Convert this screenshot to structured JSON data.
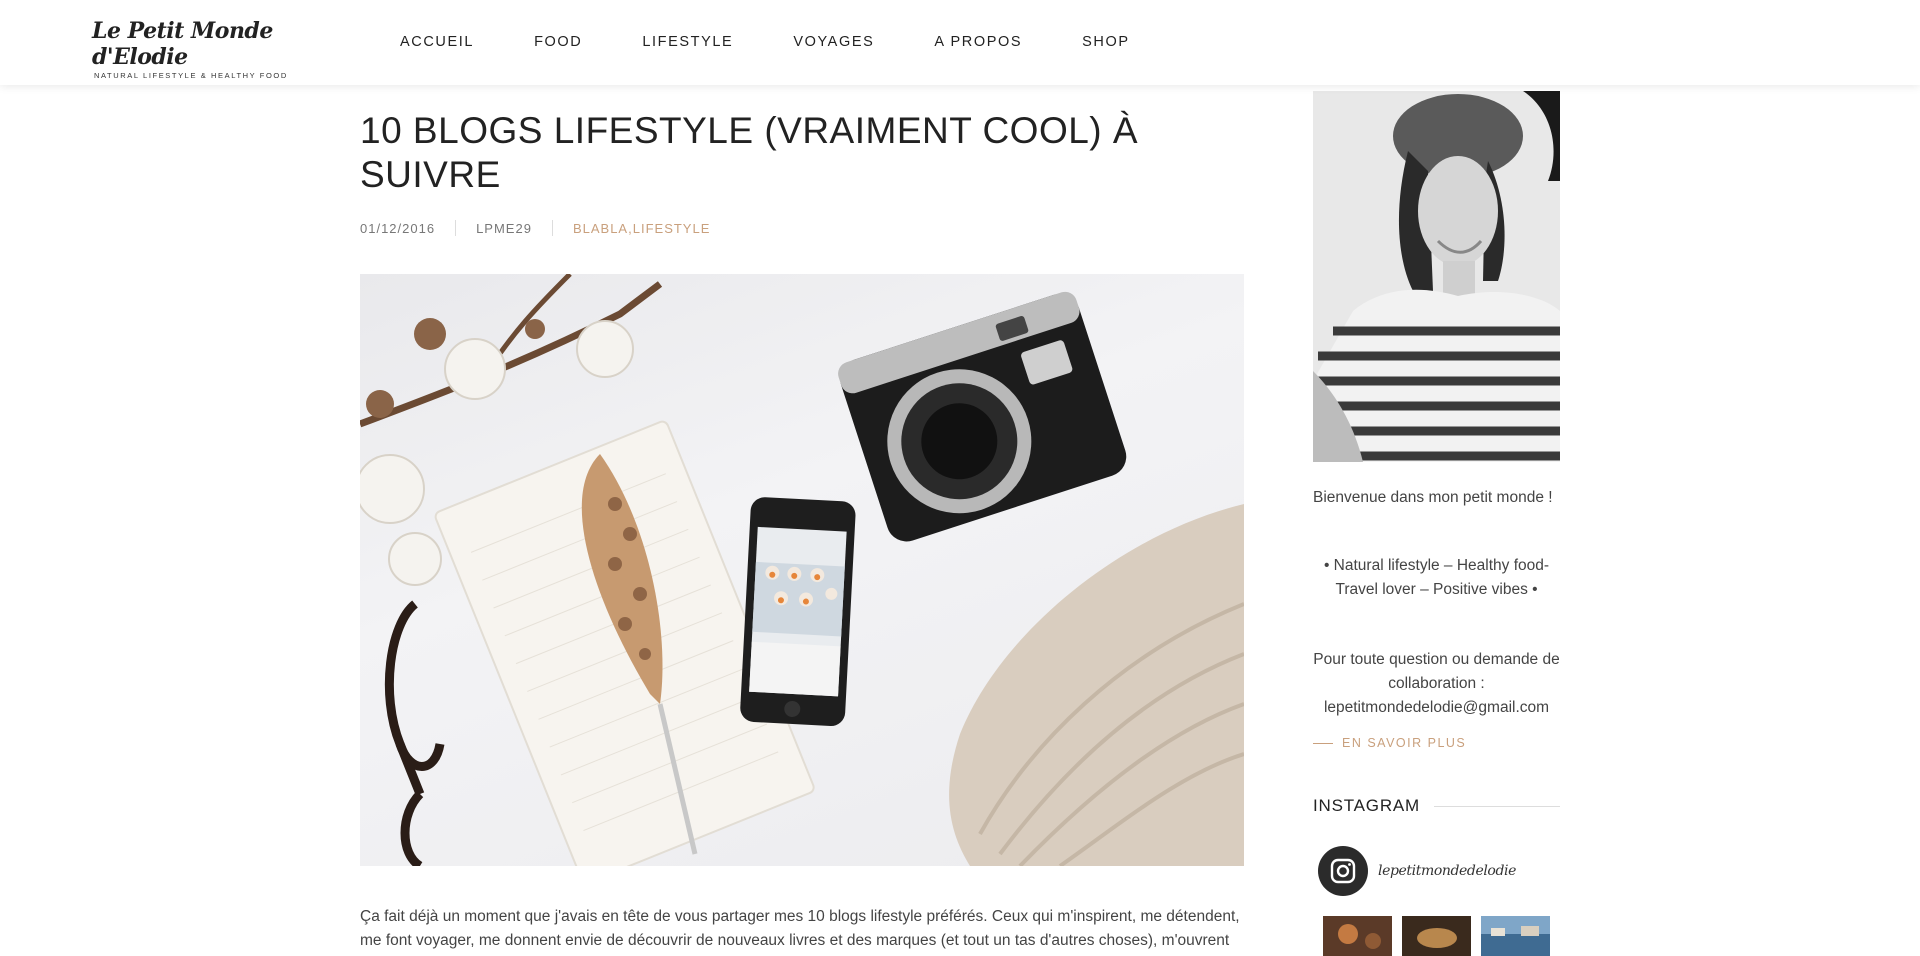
{
  "site": {
    "logo_script": "Le Petit Monde d'Elodie",
    "logo_tagline": "NATURAL LIFESTYLE & HEALTHY FOOD"
  },
  "nav": [
    {
      "label": "ACCUEIL"
    },
    {
      "label": "FOOD"
    },
    {
      "label": "LIFESTYLE"
    },
    {
      "label": "VOYAGES"
    },
    {
      "label": "A PROPOS"
    },
    {
      "label": "SHOP"
    }
  ],
  "article": {
    "title": "10 BLOGS LIFESTYLE (VRAIMENT COOL) À SUIVRE",
    "date": "01/12/2016",
    "author": "LPME29",
    "category_1": "BLABLA",
    "category_sep": ",",
    "category_2": "LIFESTYLE",
    "intro_line_1": "Ça fait déjà un moment que j'avais en tête de vous partager mes 10 blogs lifestyle préférés. Ceux qui m'inspirent, me détendent,",
    "intro_line_2": "me font voyager, me donnent envie de découvrir de nouveaux livres et des marques (et tout un tas d'autres choses), m'ouvrent"
  },
  "sidebar": {
    "welcome": "Bienvenue dans mon petit monde !",
    "tagline_1": "• Natural lifestyle – Healthy food-",
    "tagline_2": "Travel lover – Positive vibes •",
    "contact_1": "Pour toute question ou demande de",
    "contact_2": "collaboration :",
    "contact_email": "lepetitmondedelodie@gmail.com",
    "more_label": "EN SAVOIR PLUS",
    "instagram_title": "INSTAGRAM",
    "instagram_handle": "lepetitmondedelodie"
  },
  "colors": {
    "accent": "#c9a07d",
    "text": "#444444",
    "heading": "#222222"
  }
}
